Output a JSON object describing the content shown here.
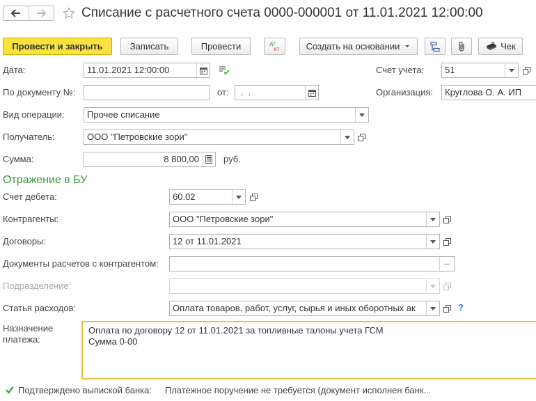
{
  "header": {
    "title": "Списание с расчетного счета 0000-000001 от 11.01.2021 12:00:00"
  },
  "toolbar": {
    "post_close": "Провести и закрыть",
    "save": "Записать",
    "post": "Провести",
    "dt_kt_top": "дт",
    "dt_kt_bottom": "кт",
    "create_based": "Создать на основании",
    "receipt": "Чек"
  },
  "form": {
    "date_label": "Дата:",
    "date_value": "11.01.2021 12:00:00",
    "account_label": "Счет учета:",
    "account_value": "51",
    "doc_no_label": "По документу №:",
    "doc_no_value": "",
    "from_label": "от:",
    "from_value": " .  .",
    "org_label": "Организация:",
    "org_value": "Круглова О. А. ИП",
    "op_type_label": "Вид операции:",
    "op_type_value": "Прочее списание",
    "recipient_label": "Получатель:",
    "recipient_value": "ООО \"Петровские зори\"",
    "amount_label": "Сумма:",
    "amount_value": "8 800,00",
    "currency": "руб."
  },
  "accounting": {
    "section_title": "Отражение в БУ",
    "debit_label": "Счет дебета:",
    "debit_value": "60.02",
    "counterparty_label": "Контрагенты:",
    "counterparty_value": "ООО \"Петровские зори\"",
    "contracts_label": "Договоры:",
    "contracts_value": "12 от 11.01.2021",
    "settlement_docs_label": "Документы расчетов с контрагентом:",
    "settlement_docs_value": "",
    "dots": "...",
    "subdivision_label": "Подразделение:",
    "subdivision_value": "",
    "expense_item_label": "Статья расходов:",
    "expense_item_value": "Оплата товаров, работ, услуг, сырья и иных оборотных ак",
    "help": "?"
  },
  "purpose": {
    "label_line1": "Назначение",
    "label_line2": "платежа:",
    "line1": "Оплата по договору 12 от 11.01.2021 за топливные талоны учета ГСМ",
    "line2": "Сумма 0-00"
  },
  "footer": {
    "confirmed_label": "Подтверждено выпиской банка:",
    "confirmed_checked": true,
    "status_text": "Платежное поручение не требуется (документ исполнен банк..."
  },
  "colors": {
    "primary_button": "#fbe33d",
    "section_title": "#3a9a3a",
    "memo_border": "#e6c33a",
    "help": "#2a7fd4"
  }
}
